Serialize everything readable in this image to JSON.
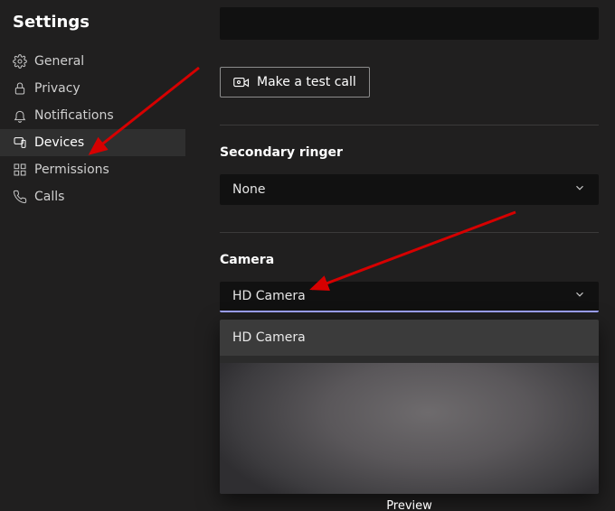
{
  "title": "Settings",
  "sidebar": {
    "items": [
      {
        "label": "General"
      },
      {
        "label": "Privacy"
      },
      {
        "label": "Notifications"
      },
      {
        "label": "Devices"
      },
      {
        "label": "Permissions"
      },
      {
        "label": "Calls"
      }
    ]
  },
  "test_call": {
    "label": "Make a test call"
  },
  "secondary_ringer": {
    "label": "Secondary ringer",
    "value": "None"
  },
  "camera": {
    "label": "Camera",
    "value": "HD Camera",
    "options": [
      "HD Camera"
    ],
    "preview_label": "Preview"
  }
}
